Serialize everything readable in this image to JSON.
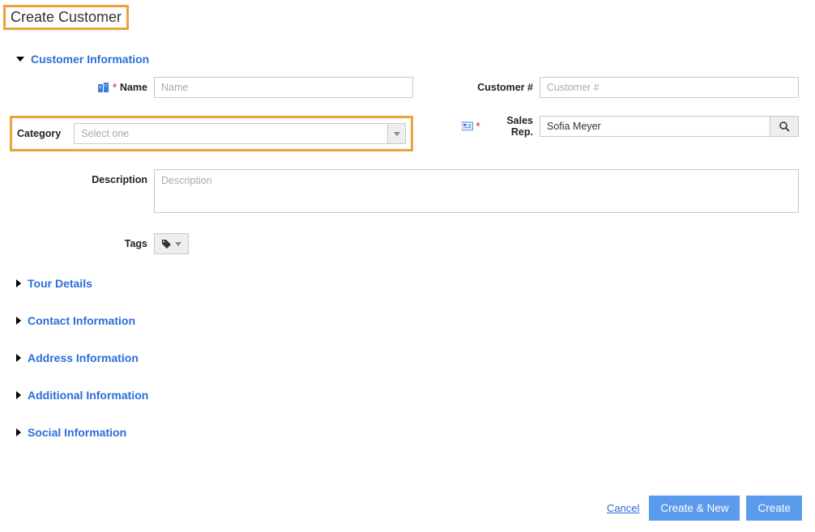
{
  "page": {
    "title": "Create Customer"
  },
  "sections": {
    "customer_info": {
      "title": "Customer Information",
      "expanded": true
    },
    "tour_details": {
      "title": "Tour Details",
      "expanded": false
    },
    "contact_info": {
      "title": "Contact Information",
      "expanded": false
    },
    "address_info": {
      "title": "Address Information",
      "expanded": false
    },
    "additional_info": {
      "title": "Additional Information",
      "expanded": false
    },
    "social_info": {
      "title": "Social Information",
      "expanded": false
    }
  },
  "fields": {
    "name": {
      "label": "Name",
      "placeholder": "Name",
      "value": "",
      "required": true
    },
    "category": {
      "label": "Category",
      "placeholder": "Select one",
      "value": ""
    },
    "description": {
      "label": "Description",
      "placeholder": "Description",
      "value": ""
    },
    "tags": {
      "label": "Tags"
    },
    "customer_no": {
      "label": "Customer #",
      "placeholder": "Customer #",
      "value": ""
    },
    "sales_rep": {
      "label": "Sales Rep.",
      "value": "Sofia Meyer",
      "required": true
    }
  },
  "footer": {
    "cancel": "Cancel",
    "create_new": "Create & New",
    "create": "Create"
  }
}
